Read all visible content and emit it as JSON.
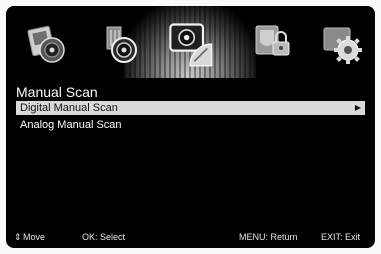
{
  "header": {
    "icons": [
      "picture-icon",
      "sound-icon",
      "channel-icon",
      "lock-icon",
      "setup-icon"
    ],
    "active_icon": "channel-icon"
  },
  "page": {
    "title": "Manual Scan"
  },
  "list": {
    "items": [
      {
        "label": "Digital Manual Scan",
        "selected": true,
        "arrow": "▶"
      },
      {
        "label": "Analog Manual Scan",
        "selected": false
      }
    ]
  },
  "footer": {
    "move": "Move",
    "move_icon": "⇕",
    "select": "OK: Select",
    "return": "MENU: Return",
    "exit": "EXIT: Exit"
  },
  "colors": {
    "background": "#000000",
    "highlight": "#d9d9d9",
    "text": "#ffffff"
  }
}
